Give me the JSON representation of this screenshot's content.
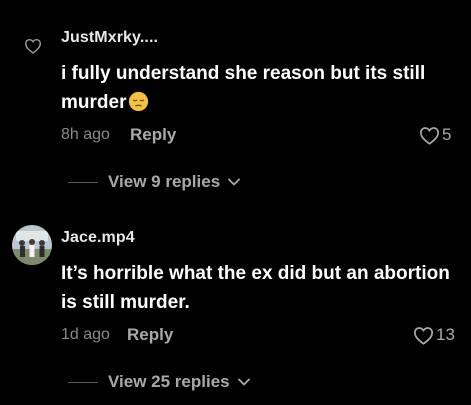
{
  "comments": [
    {
      "author": "JustMxrky....",
      "text": "i fully understand she reason but its still murder",
      "emoji": "pensive-face",
      "time": "8h ago",
      "reply_label": "Reply",
      "likes": "5",
      "view_replies": "View 9 replies"
    },
    {
      "author": "Jace.mp4",
      "text": "It’s horrible what the ex did but an abortion is still murder.",
      "time": "1d ago",
      "reply_label": "Reply",
      "likes": "13",
      "view_replies": "View 25 replies"
    }
  ],
  "icons": {
    "like": "heart-outline-icon",
    "expand": "chevron-down-icon"
  }
}
